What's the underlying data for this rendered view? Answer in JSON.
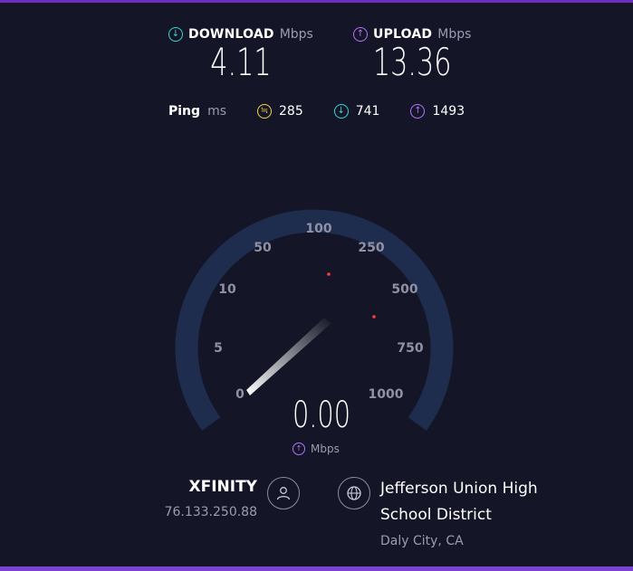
{
  "download": {
    "label": "DOWNLOAD",
    "unit": "Mbps",
    "value": "4.11"
  },
  "upload": {
    "label": "UPLOAD",
    "unit": "Mbps",
    "value": "13.36"
  },
  "ping": {
    "label": "Ping",
    "unit": "ms",
    "idle": "285",
    "download": "741",
    "upload": "1493"
  },
  "gauge": {
    "ticks": [
      "0",
      "5",
      "10",
      "50",
      "100",
      "250",
      "500",
      "750",
      "1000"
    ],
    "current_value": "0.00",
    "current_unit": "Mbps",
    "needle_value": 0
  },
  "isp": {
    "name": "XFINITY",
    "ip": "76.133.250.88"
  },
  "server": {
    "name": "Jefferson Union High School District",
    "location": "Daly City, CA"
  },
  "colors": {
    "background": "#141526",
    "download": "#38d7d6",
    "upload": "#b772ff",
    "ping": "#f3d34a",
    "gauge_track": "#1e2d4d",
    "accent_bar": "#6f2cc0"
  }
}
